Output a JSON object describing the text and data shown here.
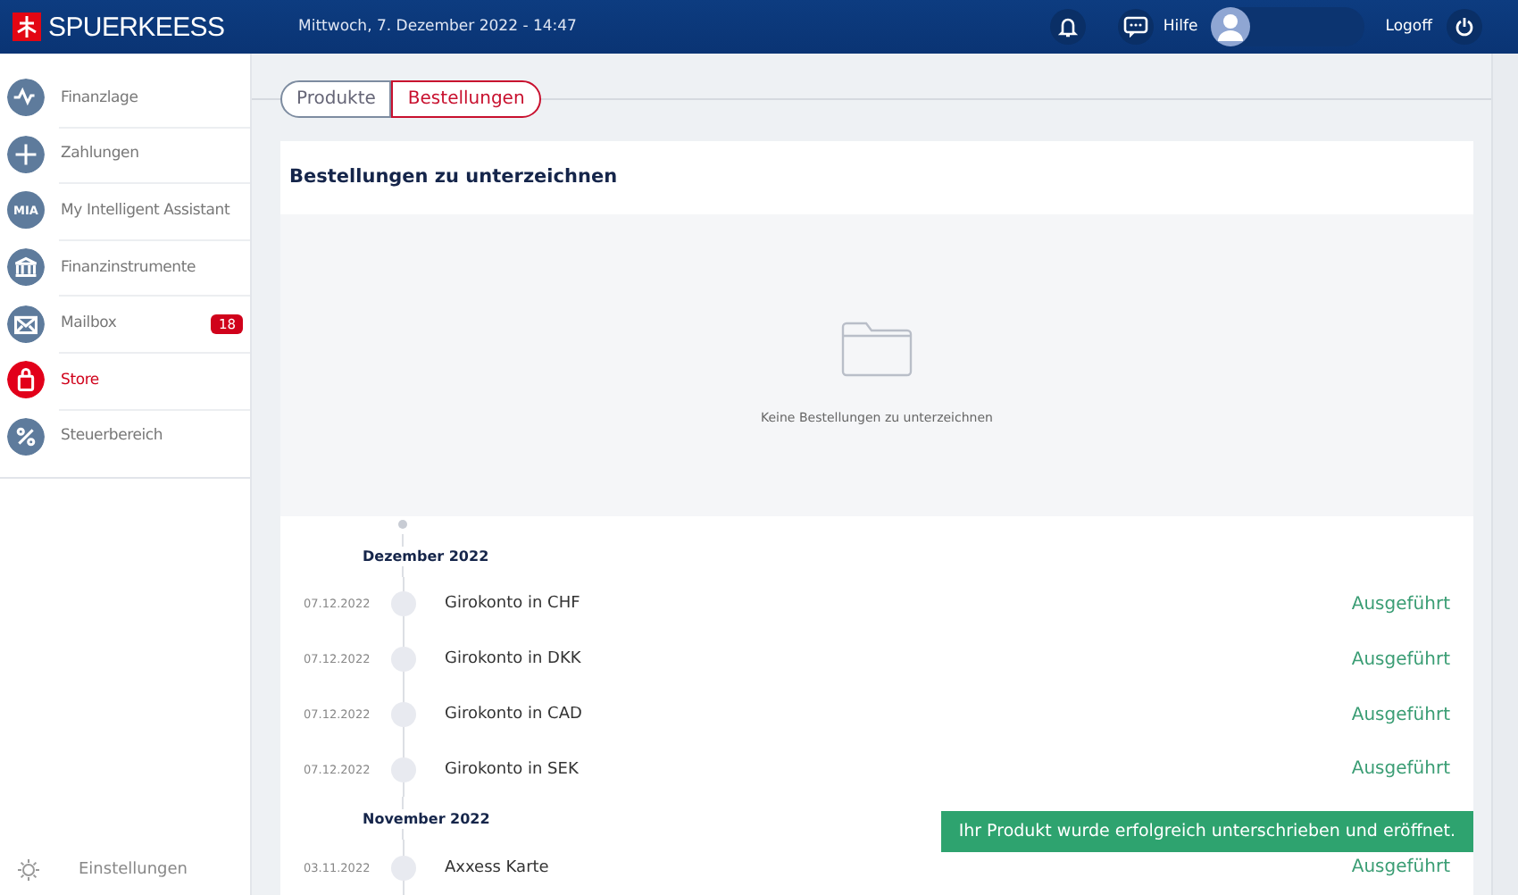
{
  "header": {
    "logo": "SPUERKEESS",
    "datetime": "Mittwoch, 7. Dezember 2022 - 14:47",
    "help": "Hilfe",
    "logoff": "Logoff"
  },
  "sidebar": {
    "items": [
      {
        "label": "Finanzlage",
        "selected": false
      },
      {
        "label": "Zahlungen",
        "selected": false
      },
      {
        "label": "My Intelligent Assistant",
        "icon_text": "MIA",
        "selected": false
      },
      {
        "label": "Finanzinstrumente",
        "selected": false
      },
      {
        "label": "Mailbox",
        "badge": "18",
        "selected": false
      },
      {
        "label": "Store",
        "selected": true
      },
      {
        "label": "Steuerbereich",
        "selected": false
      }
    ],
    "settings": "Einstellungen"
  },
  "tabs": [
    {
      "label": "Produkte",
      "selected": false
    },
    {
      "label": "Bestellungen",
      "selected": true
    }
  ],
  "section": {
    "title": "Bestellungen zu unterzeichnen",
    "empty_message": "Keine Bestellungen zu unterzeichnen"
  },
  "timeline": [
    {
      "month": "Dezember 2022",
      "entries": [
        {
          "date": "07.12.2022",
          "name": "Girokonto in CHF",
          "status": "Ausgeführt"
        },
        {
          "date": "07.12.2022",
          "name": "Girokonto in DKK",
          "status": "Ausgeführt"
        },
        {
          "date": "07.12.2022",
          "name": "Girokonto in CAD",
          "status": "Ausgeführt"
        },
        {
          "date": "07.12.2022",
          "name": "Girokonto in SEK",
          "status": "Ausgeführt"
        }
      ]
    },
    {
      "month": "November 2022",
      "entries": [
        {
          "date": "03.11.2022",
          "name": "Axxess Karte",
          "status": "Ausgeführt"
        }
      ]
    }
  ],
  "toast": "Ihr Produkt wurde erfolgreich unterschrieben und eröffnet."
}
